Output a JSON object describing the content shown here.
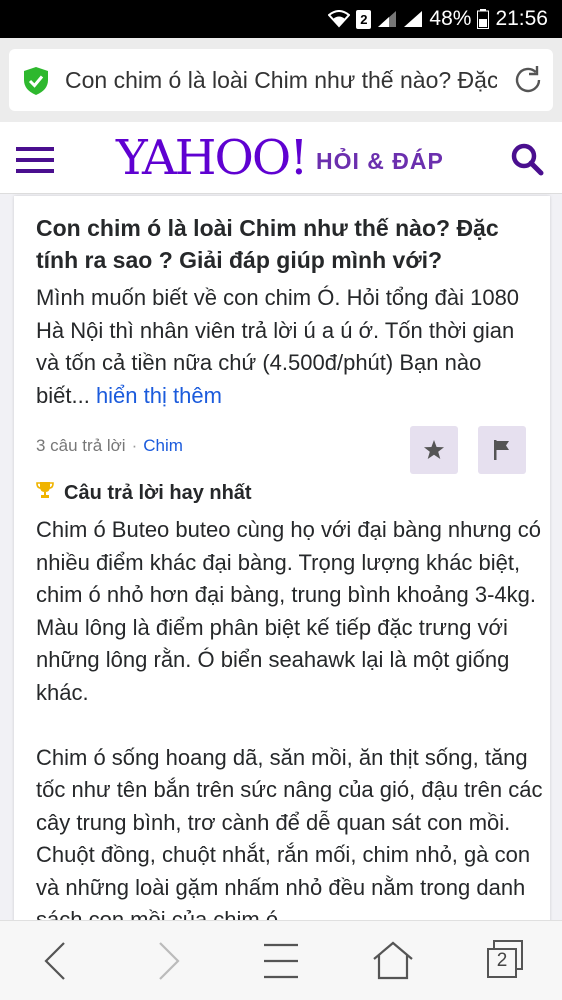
{
  "status_bar": {
    "sim": "2",
    "battery": "48%",
    "time": "21:56"
  },
  "url_bar": {
    "url_text": "Con chim ó là loài Chim như thế nào? Đặc tính ra sao ? Giải đáp giúp mình với?"
  },
  "header": {
    "logo": "YAHOO!",
    "section": "HỎI & ĐÁP"
  },
  "question": {
    "title": "Con chim ó là loài Chim như thế nào? Đặc tính ra sao ? Giải đáp giúp mình với?",
    "body": "Mình muốn biết về con chim Ó. Hỏi tổng đài 1080 Hà Nội thì nhân viên trả lời ú a ú ớ. Tốn thời gian và tốn cả tiền nữa chứ (4.500đ/phút) Bạn nào biết...",
    "more_link": "hiển thị thêm",
    "answers_count": "3 câu trả lời",
    "separator": "·",
    "category": "Chim"
  },
  "best_answer": {
    "label": "Câu trả lời hay nhất",
    "paragraphs": [
      "Chim ó Buteo buteo cùng họ với đại bàng nhưng có nhiều điểm khác đại bàng. Trọng lượng khác biệt, chim ó nhỏ hơn đại bàng, trung bình khoảng 3-4kg. Màu lông là điểm phân biệt kế tiếp đặc trưng với những lông rằn. Ó biển seahawk lại là một giống khác.",
      "Chim ó sống hoang dã, săn mồi, ăn thịt sống, tăng tốc như tên bắn trên sức nâng của gió, đậu trên các cây trung bình, trơ cành để dễ quan sát con mồi. Chuột đồng, chuột nhắt, rắn mối, chim nhỏ, gà con và những loài gặm nhấm nhỏ đều nằm trong danh sách con mồi của chim ó."
    ]
  },
  "bottom_nav": {
    "tabs_count": "2"
  },
  "colors": {
    "yahoo_purple": "#5f01d1",
    "link_blue": "#1b5bdc",
    "shield_green": "#2eb82e"
  }
}
